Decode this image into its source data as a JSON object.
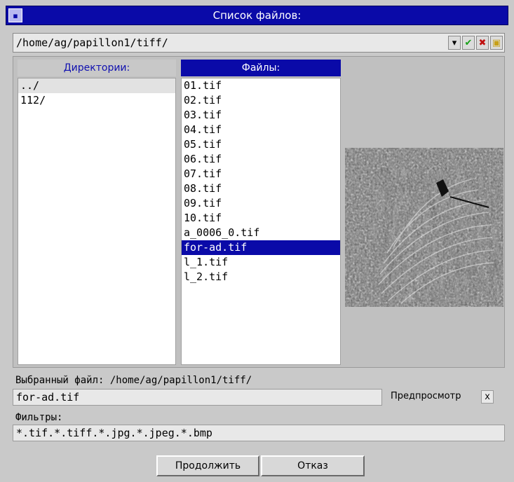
{
  "window": {
    "title": "Список файлов:",
    "menu_glyph": "▪"
  },
  "path_bar": {
    "value": "/home/ag/papillon1/tiff/",
    "icons": [
      "dropdown-arrow-icon",
      "check-icon",
      "close-icon",
      "new-folder-icon"
    ],
    "icon_glyphs": {
      "dropdown": "▾",
      "check": "✔",
      "close": "✖",
      "folder": "▣"
    },
    "colors": {
      "check": "#18a018",
      "close": "#c01010",
      "folder": "#c8a018"
    }
  },
  "directories": {
    "header": "Директории:",
    "items": [
      "../",
      "112/"
    ]
  },
  "files": {
    "header": "Файлы:",
    "items": [
      "01.tif",
      "02.tif",
      "03.tif",
      "04.tif",
      "05.tif",
      "06.tif",
      "07.tif",
      "08.tif",
      "09.tif",
      "10.tif",
      "a_0006_0.tif",
      "for-ad.tif",
      "l_1.tif",
      "l_2.tif"
    ],
    "selected": "for-ad.tif"
  },
  "selected_file": {
    "label": "Выбранный файл: /home/ag/papillon1/tiff/",
    "value": "for-ad.tif"
  },
  "preview_toggle": {
    "label": "Предпросмотр",
    "checked_mark": "x"
  },
  "filters": {
    "label": "Фильтры:",
    "value": "*.tif.*.tiff.*.jpg.*.jpeg.*.bmp"
  },
  "buttons": {
    "continue": "Продолжить",
    "cancel": "Отказ"
  },
  "colors": {
    "accent": "#0a0aa8",
    "background": "#c9c9c9"
  }
}
